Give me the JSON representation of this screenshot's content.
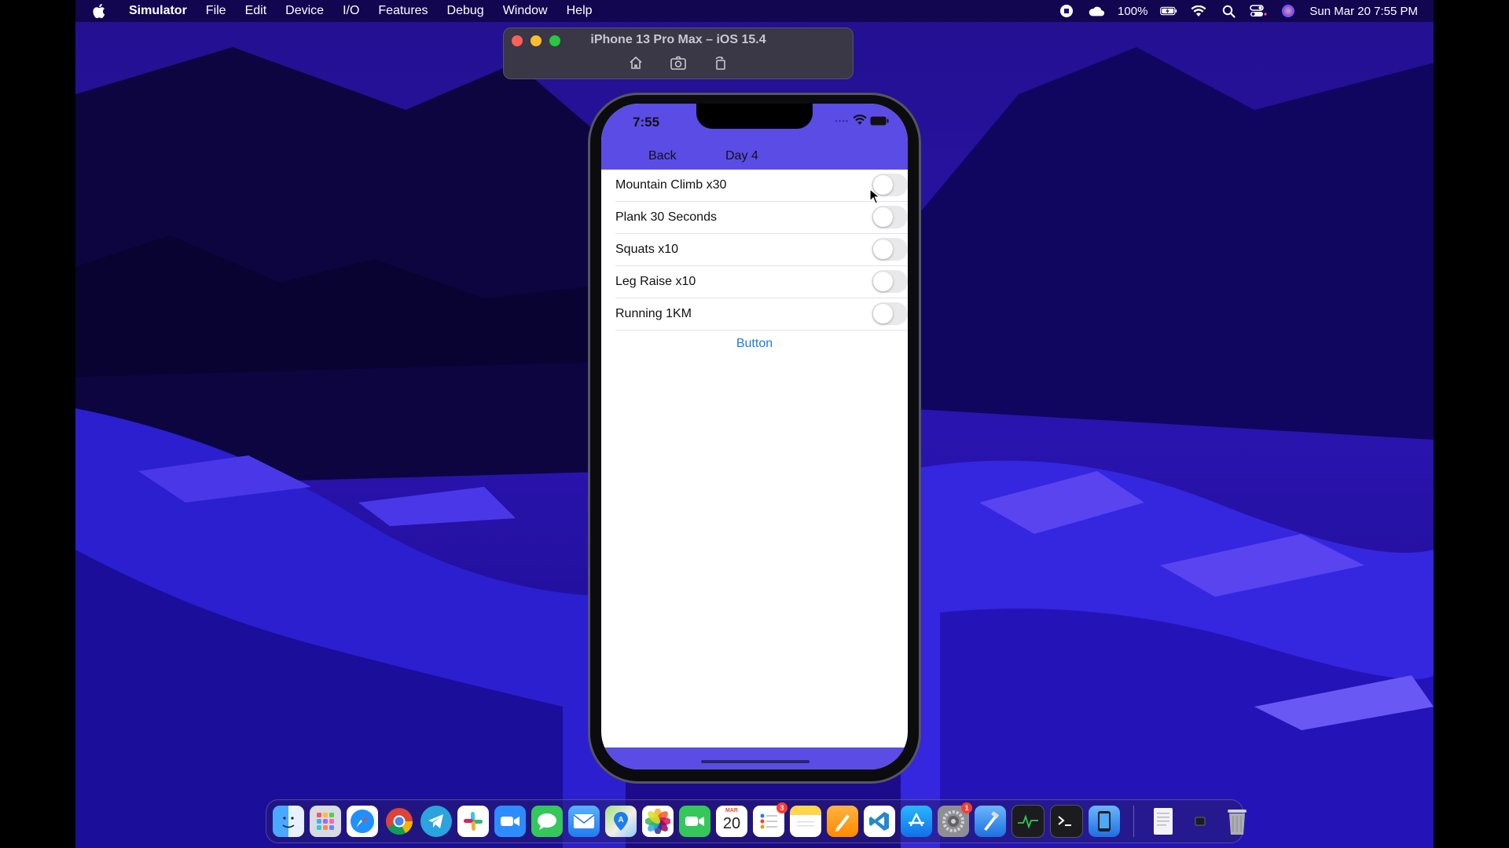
{
  "menubar": {
    "app_name": "Simulator",
    "items": [
      "File",
      "Edit",
      "Device",
      "I/O",
      "Features",
      "Debug",
      "Window",
      "Help"
    ],
    "battery_percent": "100%",
    "datetime": "Sun Mar 20  7:55 PM"
  },
  "simulator_window": {
    "title": "iPhone 13 Pro Max – iOS 15.4",
    "tools": [
      "home-icon",
      "screenshot-icon",
      "rotate-icon"
    ]
  },
  "phone": {
    "status_time": "7:55",
    "nav": {
      "back_label": "Back",
      "title": "Day 4"
    },
    "exercises": [
      {
        "label": "Mountain Climb x30",
        "on": false
      },
      {
        "label": "Plank 30 Seconds",
        "on": false
      },
      {
        "label": "Squats x10",
        "on": false
      },
      {
        "label": "Leg Raise x10",
        "on": false
      },
      {
        "label": "Running 1KM",
        "on": false
      }
    ],
    "button_label": "Button",
    "accent_color": "#5b4ce6",
    "button_color": "#1e7ae3"
  },
  "dock": {
    "apps": [
      {
        "name": "finder-icon"
      },
      {
        "name": "launchpad-icon"
      },
      {
        "name": "safari-icon"
      },
      {
        "name": "chrome-icon"
      },
      {
        "name": "telegram-icon"
      },
      {
        "name": "slack-icon"
      },
      {
        "name": "zoom-icon"
      },
      {
        "name": "messages-icon"
      },
      {
        "name": "mail-icon"
      },
      {
        "name": "maps-icon"
      },
      {
        "name": "photos-icon"
      },
      {
        "name": "facetime-icon"
      },
      {
        "name": "calendar-icon"
      },
      {
        "name": "reminders-icon"
      },
      {
        "name": "notes-icon"
      },
      {
        "name": "pages-icon"
      },
      {
        "name": "vscode-icon"
      },
      {
        "name": "app-store-icon"
      },
      {
        "name": "system-preferences-icon"
      },
      {
        "name": "xcode-icon"
      },
      {
        "name": "activity-monitor-icon"
      },
      {
        "name": "terminal-icon"
      },
      {
        "name": "simulator-icon"
      }
    ],
    "calendar_month": "MAR",
    "calendar_day": "20",
    "reminders_badge": "3",
    "system_preferences_badge": "1"
  }
}
